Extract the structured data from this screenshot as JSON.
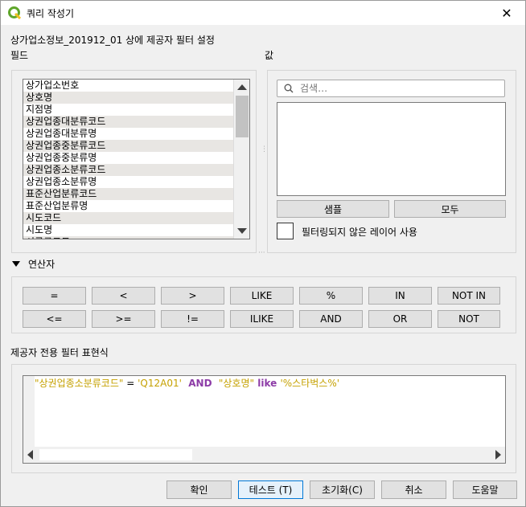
{
  "window": {
    "title": "쿼리 작성기",
    "close": "✕"
  },
  "subtitle": "상가업소정보_201912_01 상에 제공자 필터 설정",
  "fields": {
    "label": "필드",
    "items": [
      "상가업소번호",
      "상호명",
      "지점명",
      "상권업종대분류코드",
      "상권업종대분류명",
      "상권업종중분류코드",
      "상권업종중분류명",
      "상권업종소분류코드",
      "상권업종소분류명",
      "표준산업분류코드",
      "표준산업분류명",
      "시도코드",
      "시도명",
      "시군구코드"
    ]
  },
  "values": {
    "label": "값",
    "search_placeholder": "검색…",
    "sample_button": "샘플",
    "all_button": "모두",
    "unfiltered_checkbox_label": "필터링되지 않은 레이어 사용"
  },
  "operators": {
    "label": "연산자",
    "row1": [
      "=",
      "<",
      ">",
      "LIKE",
      "%",
      "IN",
      "NOT IN"
    ],
    "row2": [
      "<=",
      ">=",
      "!=",
      "ILIKE",
      "AND",
      "OR",
      "NOT"
    ]
  },
  "expression": {
    "label": "제공자 전용 필터 표현식",
    "tokens": [
      {
        "text": "\"상권업종소분류코드\"",
        "kind": "str"
      },
      {
        "text": " = ",
        "kind": "op"
      },
      {
        "text": "'Q12A01'",
        "kind": "str"
      },
      {
        "text": "  AND  ",
        "kind": "kw"
      },
      {
        "text": "\"상호명\"",
        "kind": "str"
      },
      {
        "text": " like ",
        "kind": "kw"
      },
      {
        "text": "'%스타벅스%'",
        "kind": "str"
      }
    ]
  },
  "footer": {
    "ok": "확인",
    "test": "테스트 (T)",
    "reset": "초기화(C)",
    "cancel": "취소",
    "help": "도움말"
  },
  "colors": {
    "string": "#c5a100",
    "keyword": "#8d3ca7",
    "accent": "#0078d7"
  }
}
